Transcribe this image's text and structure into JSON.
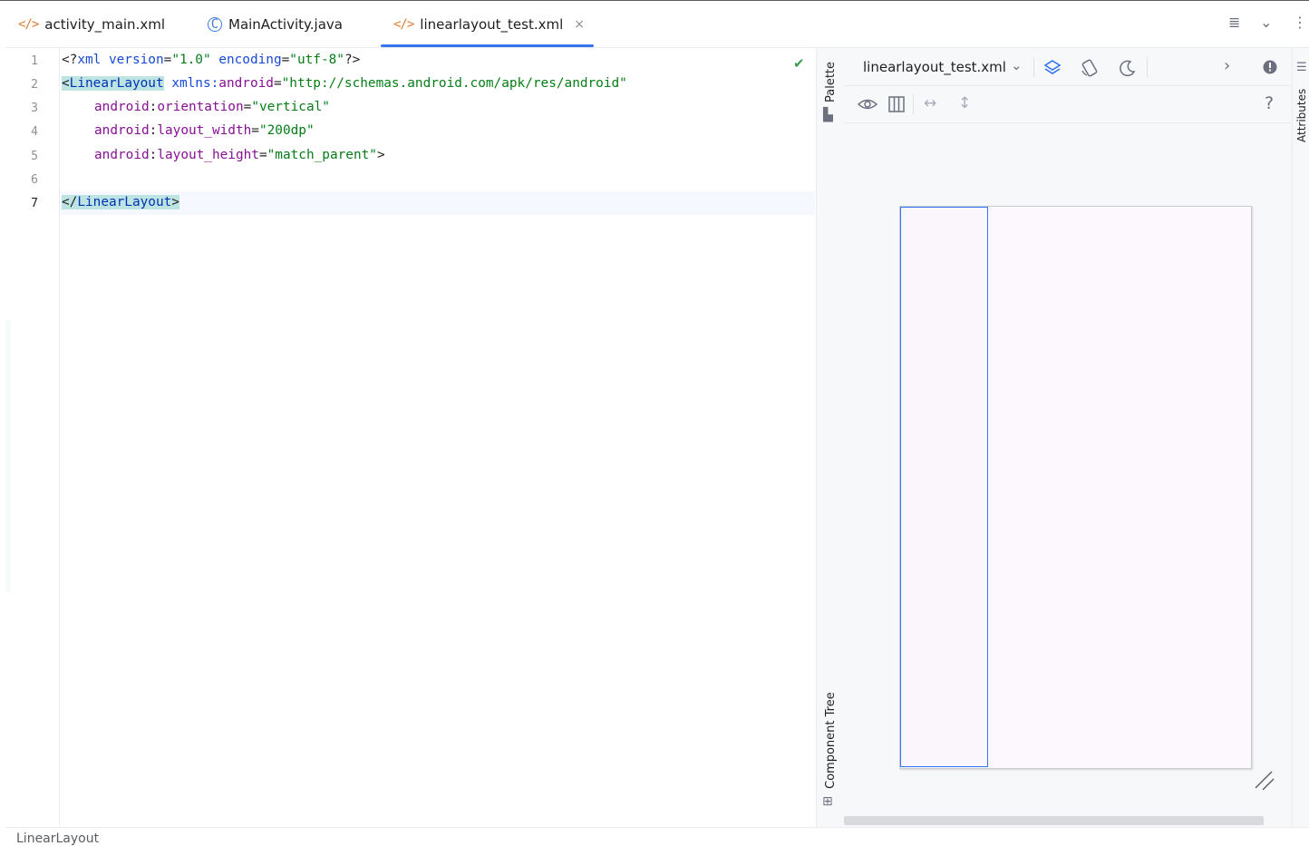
{
  "tabs": [
    {
      "label": "activity_main.xml",
      "icon": "xml-file-icon"
    },
    {
      "label": "MainActivity.java",
      "icon": "java-class-icon",
      "icon_glyph": "C"
    },
    {
      "label": "linearlayout_test.xml",
      "icon": "xml-file-icon",
      "active": true
    }
  ],
  "tab_close_glyph": "×",
  "xml_icon_glyph": "</>",
  "editor": {
    "line_numbers": [
      "1",
      "2",
      "3",
      "4",
      "5",
      "6",
      "7"
    ],
    "current_line": "7",
    "lines": [
      {
        "parts": [
          "<?",
          "xml version",
          "=",
          "\"1.0\"",
          " encoding",
          "=",
          "\"utf-8\"",
          "?>"
        ]
      },
      {
        "parts": [
          "<",
          "LinearLayout",
          " ",
          "xmlns:",
          "android",
          "=",
          "\"http://schemas.android.com/apk/res/android\""
        ]
      },
      {
        "parts": [
          "android",
          ":",
          "orientation",
          "=",
          "\"vertical\""
        ]
      },
      {
        "parts": [
          "android",
          ":",
          "layout_width",
          "=",
          "\"200dp\""
        ]
      },
      {
        "parts": [
          "android",
          ":",
          "layout_height",
          "=",
          "\"match_parent\"",
          ">"
        ]
      },
      {
        "parts": []
      },
      {
        "parts": [
          "</",
          "LinearLayout",
          ">"
        ]
      }
    ]
  },
  "side_panels": {
    "palette": "Palette",
    "component_tree": "Component Tree",
    "attributes": "Attributes"
  },
  "design": {
    "file_label": "linearlayout_test.xml",
    "dropdown_glyph": "⌄",
    "help_glyph": "?",
    "expand_glyph": "›"
  },
  "status_bar": {
    "text": "LinearLayout"
  },
  "colors": {
    "accent": "#3574f0",
    "tag": "#0033b3",
    "attribute": "#871094",
    "string": "#067d17",
    "highlight": "#bde4e3",
    "check": "#3f9a52"
  }
}
